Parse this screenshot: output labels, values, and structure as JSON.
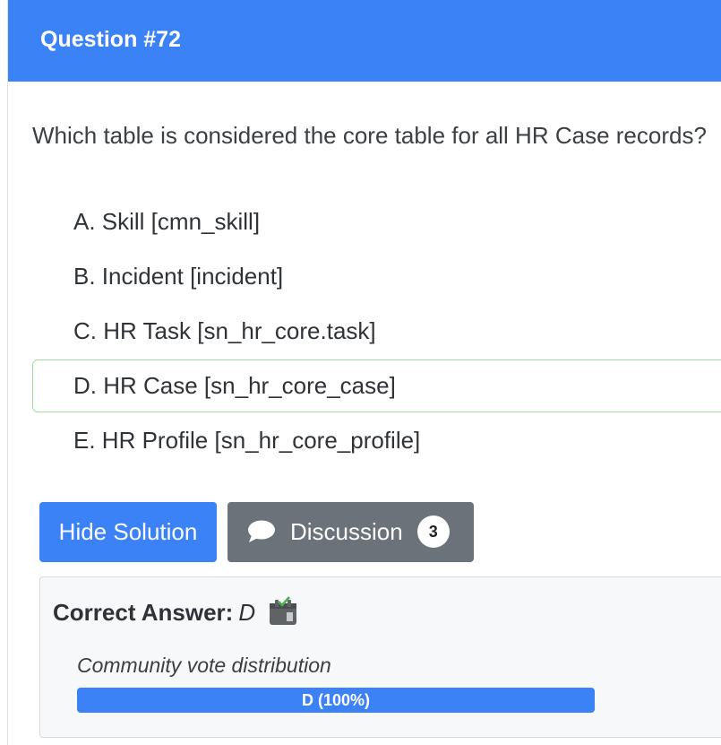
{
  "header": {
    "title": "Question #72"
  },
  "question": {
    "text": "Which table is considered the core table for all HR Case records?"
  },
  "choices": [
    {
      "label": "A. Skill [cmn_skill]",
      "correct": false
    },
    {
      "label": "B. Incident [incident]",
      "correct": false
    },
    {
      "label": "C. HR Task [sn_hr_core.task]",
      "correct": false
    },
    {
      "label": "D. HR Case [sn_hr_core_case]",
      "correct": true
    },
    {
      "label": "E. HR Profile [sn_hr_core_profile]",
      "correct": false
    }
  ],
  "buttons": {
    "solution_label": "Hide Solution",
    "discussion_label": "Discussion",
    "discussion_count": "3"
  },
  "answer": {
    "label": "Correct Answer:",
    "value": "D",
    "vote_title": "Community vote distribution",
    "vote_bar_label": "D (100%)",
    "vote_percent": 100
  },
  "colors": {
    "primary": "#3b82f6",
    "secondary": "#6b7279",
    "correct_border": "#a6d9a4"
  },
  "icons": {
    "discussion": "comment-bubble-icon",
    "answer": "calendar-check-icon"
  }
}
